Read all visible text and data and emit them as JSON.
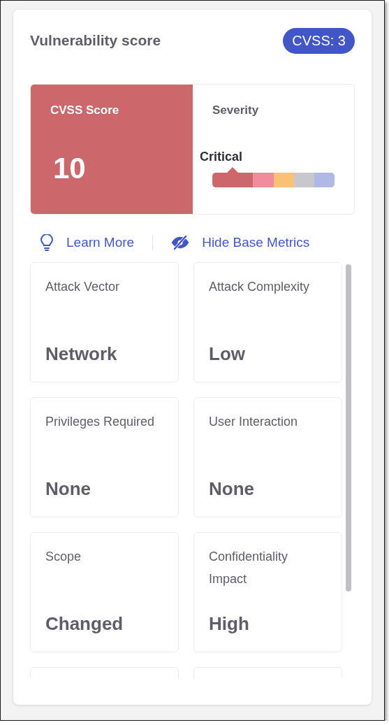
{
  "panel": {
    "title": "Vulnerability score",
    "badge": "CVSS: 3"
  },
  "score": {
    "label": "CVSS Score",
    "value": "10",
    "color": "#cc676c"
  },
  "severity": {
    "label": "Severity",
    "level_label": "Critical",
    "scale": [
      {
        "color": "#cc676c",
        "selected": true
      },
      {
        "color": "#f28b9b",
        "selected": false
      },
      {
        "color": "#f9c174",
        "selected": false
      },
      {
        "color": "#c8c8cc",
        "selected": false
      },
      {
        "color": "#b0b9e6",
        "selected": false
      }
    ]
  },
  "links": [
    {
      "kind": "bulb",
      "label": "Learn More"
    },
    {
      "kind": "eye-off",
      "label": "Hide Base Metrics"
    }
  ],
  "metrics": [
    {
      "kind": "metric",
      "name": "Attack Vector",
      "value": "Network"
    },
    {
      "kind": "metric",
      "name": "Attack Complexity",
      "value": "Low"
    },
    {
      "kind": "metric",
      "name": "Privileges Required",
      "value": "None"
    },
    {
      "kind": "metric",
      "name": "User Interaction",
      "value": "None"
    },
    {
      "kind": "metric",
      "name": "Scope",
      "value": "Changed"
    },
    {
      "kind": "metric",
      "name": "Confidentiality Impact",
      "value": "High"
    },
    {
      "kind": "clipped"
    },
    {
      "kind": "clipped"
    }
  ]
}
